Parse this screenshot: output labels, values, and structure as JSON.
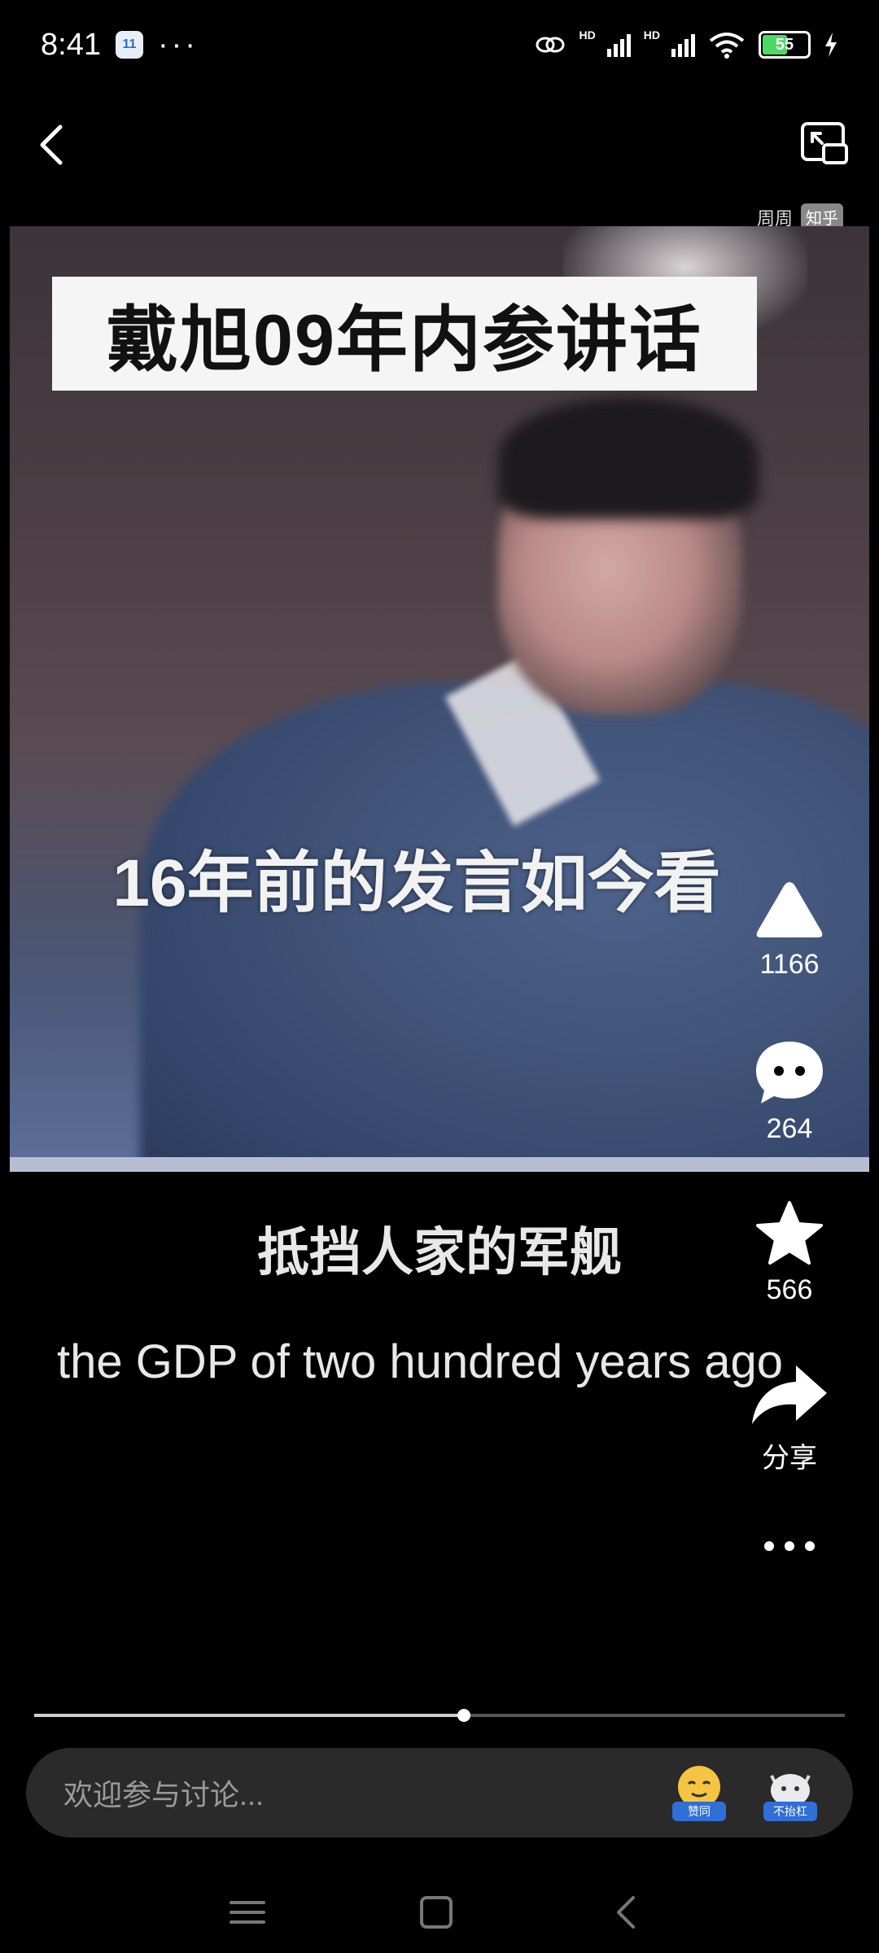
{
  "status_bar": {
    "time": "8:41",
    "calendar_day": "11",
    "more": "···",
    "battery": "55"
  },
  "watermark": {
    "author": "周周",
    "platform": "知乎"
  },
  "video": {
    "title_overlay": "戴旭09年内参讲话",
    "subtitle_overlay": "16年前的发言如今看",
    "caption_cn": "抵挡人家的军舰",
    "caption_en": "the GDP of two hundred years ago"
  },
  "actions": {
    "like_count": "1166",
    "comment_count": "264",
    "favorite_count": "566",
    "share_label": "分享"
  },
  "progress": {
    "fraction": 0.53
  },
  "comment_bar": {
    "placeholder": "欢迎参与讨论...",
    "agree_label": "赞同",
    "no_argue_label": "不抬杠"
  },
  "colors": {
    "background": "#000000",
    "input_bg": "#2a2a2a",
    "battery_green": "#4cd964",
    "accent_blue": "#2f6fd6"
  }
}
